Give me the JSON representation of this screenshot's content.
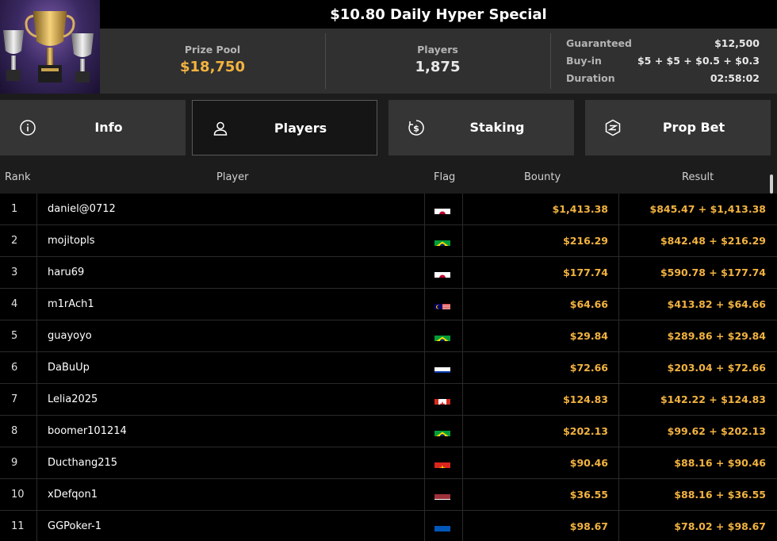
{
  "header": {
    "title": "$10.80 Daily Hyper Special",
    "prize_pool_label": "Prize Pool",
    "prize_pool_value": "$18,750",
    "players_label": "Players",
    "players_value": "1,875",
    "details": [
      {
        "key": "Guaranteed",
        "value": "$12,500"
      },
      {
        "key": "Buy-in",
        "value": "$5 + $5 + $0.5 + $0.3"
      },
      {
        "key": "Duration",
        "value": "02:58:02"
      }
    ]
  },
  "tabs": [
    {
      "label": "Info",
      "icon": "info-icon",
      "active": false
    },
    {
      "label": "Players",
      "icon": "user-icon",
      "active": true
    },
    {
      "label": "Staking",
      "icon": "dollar-coin-icon",
      "active": false
    },
    {
      "label": "Prop Bet",
      "icon": "prop-bet-icon",
      "active": false
    }
  ],
  "table": {
    "columns": {
      "rank": "Rank",
      "player": "Player",
      "flag": "Flag",
      "bounty": "Bounty",
      "result": "Result"
    },
    "rows": [
      {
        "rank": "1",
        "player": "daniel@0712",
        "flag": "japan",
        "bounty": "$1,413.38",
        "result": "$845.47 + $1,413.38"
      },
      {
        "rank": "2",
        "player": "mojitopls",
        "flag": "brazil",
        "bounty": "$216.29",
        "result": "$842.48 + $216.29"
      },
      {
        "rank": "3",
        "player": "haru69",
        "flag": "japan",
        "bounty": "$177.74",
        "result": "$590.78 + $177.74"
      },
      {
        "rank": "4",
        "player": "m1rAch1",
        "flag": "malaysia",
        "bounty": "$64.66",
        "result": "$413.82 + $64.66"
      },
      {
        "rank": "5",
        "player": "guayoyo",
        "flag": "brazil",
        "bounty": "$29.84",
        "result": "$289.86 + $29.84"
      },
      {
        "rank": "6",
        "player": "DaBuUp",
        "flag": "russia",
        "bounty": "$72.66",
        "result": "$203.04 + $72.66"
      },
      {
        "rank": "7",
        "player": "Lelia2025",
        "flag": "canada",
        "bounty": "$124.83",
        "result": "$142.22 + $124.83"
      },
      {
        "rank": "8",
        "player": "boomer101214",
        "flag": "brazil",
        "bounty": "$202.13",
        "result": "$99.62 + $202.13"
      },
      {
        "rank": "9",
        "player": "Ducthang215",
        "flag": "vietnam",
        "bounty": "$90.46",
        "result": "$88.16 + $90.46"
      },
      {
        "rank": "10",
        "player": "xDefqon1",
        "flag": "latvia",
        "bounty": "$36.55",
        "result": "$88.16 + $36.55"
      },
      {
        "rank": "11",
        "player": "GGPoker-1",
        "flag": "ukraine",
        "bounty": "$98.67",
        "result": "$78.02 + $98.67"
      }
    ]
  },
  "colors": {
    "accent": "#f3b340",
    "panel": "#303030",
    "tab": "#353535"
  }
}
